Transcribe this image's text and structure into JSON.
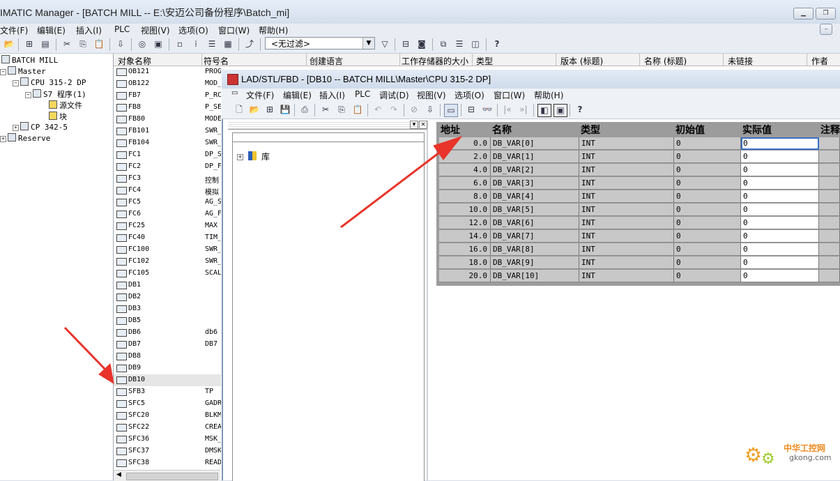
{
  "main_window": {
    "title": "IMATIC Manager - [BATCH MILL -- E:\\安迈公司备份程序\\Batch_mi]",
    "menu": [
      "文件(F)",
      "编辑(E)",
      "插入(I)",
      "PLC",
      "视图(V)",
      "选项(O)",
      "窗口(W)",
      "帮助(H)"
    ],
    "filter_value": "<无过滤>"
  },
  "tree": {
    "items": [
      {
        "label": "BATCH MILL"
      },
      {
        "label": "Master"
      },
      {
        "label": "CPU 315-2 DP"
      },
      {
        "label": "S7 程序(1)"
      },
      {
        "label": "源文件"
      },
      {
        "label": "块"
      },
      {
        "label": "CP 342-5"
      },
      {
        "label": "Reserve"
      }
    ]
  },
  "object_list": {
    "columns": [
      "对象名称",
      "符号名",
      "创建语言",
      "工作存储器的大小",
      "类型",
      "版本 (标题)",
      "名称 (标题)",
      "未链接",
      "作者"
    ],
    "rows": [
      {
        "name": "OB121",
        "symbol": "PROG"
      },
      {
        "name": "OB122",
        "symbol": "MOD_"
      },
      {
        "name": "FB7",
        "symbol": "P_RC"
      },
      {
        "name": "FB8",
        "symbol": "P_SE"
      },
      {
        "name": "FB80",
        "symbol": "MODE"
      },
      {
        "name": "FB101",
        "symbol": "SWR_"
      },
      {
        "name": "FB104",
        "symbol": "SWR_"
      },
      {
        "name": "FC1",
        "symbol": "DP_S"
      },
      {
        "name": "FC2",
        "symbol": "DP_F"
      },
      {
        "name": "FC3",
        "symbol": "控制"
      },
      {
        "name": "FC4",
        "symbol": "模拟"
      },
      {
        "name": "FC5",
        "symbol": "AG_S"
      },
      {
        "name": "FC6",
        "symbol": "AG_F"
      },
      {
        "name": "FC25",
        "symbol": "MAX"
      },
      {
        "name": "FC40",
        "symbol": "TIM_"
      },
      {
        "name": "FC100",
        "symbol": "SWR_"
      },
      {
        "name": "FC102",
        "symbol": "SWR_"
      },
      {
        "name": "FC105",
        "symbol": "SCAL"
      },
      {
        "name": "DB1",
        "symbol": ""
      },
      {
        "name": "DB2",
        "symbol": ""
      },
      {
        "name": "DB3",
        "symbol": ""
      },
      {
        "name": "DB5",
        "symbol": ""
      },
      {
        "name": "DB6",
        "symbol": "db6"
      },
      {
        "name": "DB7",
        "symbol": "DB7"
      },
      {
        "name": "DB8",
        "symbol": ""
      },
      {
        "name": "DB9",
        "symbol": ""
      },
      {
        "name": "DB10",
        "symbol": ""
      },
      {
        "name": "SFB3",
        "symbol": "TP"
      },
      {
        "name": "SFC5",
        "symbol": "GADR"
      },
      {
        "name": "SFC20",
        "symbol": "BLKM"
      },
      {
        "name": "SFC22",
        "symbol": "CREA"
      },
      {
        "name": "SFC36",
        "symbol": "MSK_"
      },
      {
        "name": "SFC37",
        "symbol": "DMSK"
      },
      {
        "name": "SFC38",
        "symbol": "READ"
      }
    ]
  },
  "editor": {
    "title": "LAD/STL/FBD  - [DB10 -- BATCH MILL\\Master\\CPU 315-2 DP]",
    "menu": [
      "文件(F)",
      "编辑(E)",
      "插入(I)",
      "PLC",
      "调试(D)",
      "视图(V)",
      "选项(O)",
      "窗口(W)",
      "帮助(H)"
    ],
    "library_label": "库",
    "table": {
      "headers": [
        "地址",
        "名称",
        "类型",
        "初始值",
        "实际值",
        "注释"
      ],
      "rows": [
        {
          "addr": "0.0",
          "name": "DB_VAR[0]",
          "type": "INT",
          "init": "0",
          "actual": "0"
        },
        {
          "addr": "2.0",
          "name": "DB_VAR[1]",
          "type": "INT",
          "init": "0",
          "actual": "0"
        },
        {
          "addr": "4.0",
          "name": "DB_VAR[2]",
          "type": "INT",
          "init": "0",
          "actual": "0"
        },
        {
          "addr": "6.0",
          "name": "DB_VAR[3]",
          "type": "INT",
          "init": "0",
          "actual": "0"
        },
        {
          "addr": "8.0",
          "name": "DB_VAR[4]",
          "type": "INT",
          "init": "0",
          "actual": "0"
        },
        {
          "addr": "10.0",
          "name": "DB_VAR[5]",
          "type": "INT",
          "init": "0",
          "actual": "0"
        },
        {
          "addr": "12.0",
          "name": "DB_VAR[6]",
          "type": "INT",
          "init": "0",
          "actual": "0"
        },
        {
          "addr": "14.0",
          "name": "DB_VAR[7]",
          "type": "INT",
          "init": "0",
          "actual": "0"
        },
        {
          "addr": "16.0",
          "name": "DB_VAR[8]",
          "type": "INT",
          "init": "0",
          "actual": "0"
        },
        {
          "addr": "18.0",
          "name": "DB_VAR[9]",
          "type": "INT",
          "init": "0",
          "actual": "0"
        },
        {
          "addr": "20.0",
          "name": "DB_VAR[10]",
          "type": "INT",
          "init": "0",
          "actual": "0"
        }
      ]
    }
  },
  "watermark": {
    "line1": "中华工控网",
    "line2": "gkong.com"
  },
  "colors": {
    "arrow": "#e8342a",
    "selected_row": "#e6e6e6",
    "grid_gray": "#c8c8c8"
  }
}
